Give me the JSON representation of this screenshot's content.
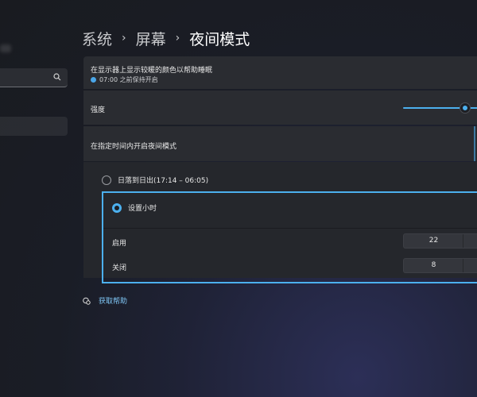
{
  "breadcrumb": {
    "items": [
      "系统",
      "屏幕",
      "夜间模式"
    ],
    "separator": "›"
  },
  "summary": {
    "description": "在显示器上显示较暖的颜色以帮助睡眠",
    "status": "07:00 之前保持开启"
  },
  "strength": {
    "label": "强度",
    "value": 0.78
  },
  "schedule": {
    "label": "在指定时间内开启夜间模式",
    "options": [
      {
        "label": "日落到日出(17:14 – 06:05)",
        "selected": false
      },
      {
        "label": "设置小时",
        "selected": true
      }
    ],
    "on_label": "启用",
    "on_value": "22",
    "off_label": "关闭",
    "off_value": "8"
  },
  "help": {
    "label": "获取帮助"
  },
  "colors": {
    "accent": "#4cb0ee",
    "card": "#2a2c31",
    "background": "#191b20"
  }
}
